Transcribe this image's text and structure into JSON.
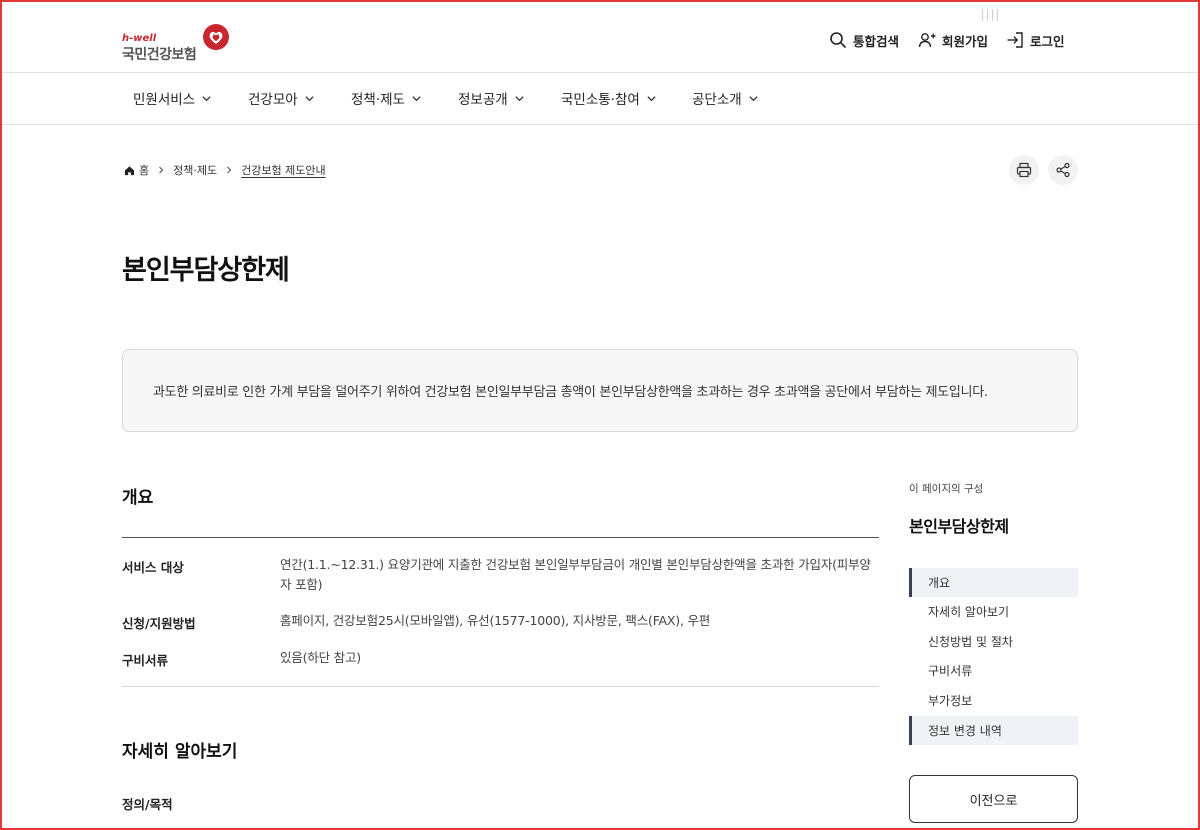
{
  "logo": {
    "sub": "h-well",
    "main": "국민건강보험"
  },
  "colors": {
    "brand_red": "#c8272e",
    "toc_accent": "#3b3f58",
    "summary_bg": "#f7f7f7"
  },
  "utility": {
    "search_label": "통합검색",
    "join_label": "회원가입",
    "login_label": "로그인"
  },
  "gnb": {
    "items": [
      {
        "label": "민원서비스"
      },
      {
        "label": "건강모아"
      },
      {
        "label": "정책·제도"
      },
      {
        "label": "정보공개"
      },
      {
        "label": "국민소통·참여"
      },
      {
        "label": "공단소개"
      }
    ]
  },
  "breadcrumb": {
    "home": "홈",
    "level1": "정책·제도",
    "current": "건강보험 제도안내"
  },
  "page": {
    "title": "본인부담상한제",
    "summary": "과도한 의료비로 인한 가계 부담을 덜어주기 위하여 건강보험 본인일부부담금 총액이 본인부담상한액을 초과하는 경우 초과액을 공단에서 부담하는 제도입니다."
  },
  "overview": {
    "title": "개요",
    "rows": [
      {
        "label": "서비스 대상",
        "value": "연간(1.1.~12.31.) 요양기관에 지출한 건강보험 본인일부부담금이 개인별 본인부담상한액을 초과한 가입자(피부양자 포함)"
      },
      {
        "label": "신청/지원방법",
        "value": "홈페이지, 건강보험25시(모바일앱), 유선(1577-1000), 지사방문, 팩스(FAX), 우편"
      },
      {
        "label": "구비서류",
        "value": "있음(하단 참고)"
      }
    ]
  },
  "detail": {
    "title": "자세히 알아보기",
    "subtitle": "정의/목적"
  },
  "toc": {
    "caption": "이 페이지의 구성",
    "title": "본인부담상한제",
    "items": [
      {
        "label": "개요"
      },
      {
        "label": "자세히 알아보기"
      },
      {
        "label": "신청방법 및 절차"
      },
      {
        "label": "구비서류"
      },
      {
        "label": "부가정보"
      },
      {
        "label": "정보 변경 내역"
      }
    ],
    "prev_label": "이전으로"
  }
}
